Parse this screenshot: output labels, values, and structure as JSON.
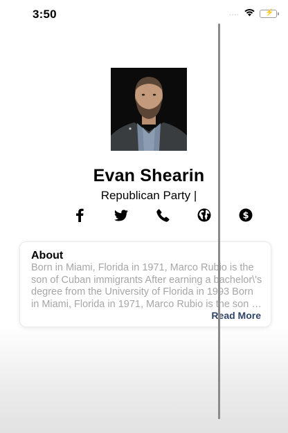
{
  "status_bar": {
    "time": "3:50",
    "signal_dots": "....",
    "battery_color": "#4cd964"
  },
  "profile": {
    "name": "Evan Shearin",
    "party": "Republican Party |",
    "photo_icon": "person-photo"
  },
  "social": [
    {
      "name": "facebook-icon"
    },
    {
      "name": "twitter-icon"
    },
    {
      "name": "phone-icon"
    },
    {
      "name": "globe-icon"
    },
    {
      "name": "dollar-icon"
    }
  ],
  "about": {
    "title": "About",
    "body": "Born in Miami, Florida in 1971, Marco Rubio is the son of Cuban immigrants After earning a bachelor\\'s degree from the University of Florida in 1993 Born in Miami, Florida in 1971, Marco Rubio is the son of Cuban immigrants",
    "read_more": "Read More"
  },
  "colors": {
    "link": "#2f4466",
    "muted_text": "#a6a6a6"
  }
}
